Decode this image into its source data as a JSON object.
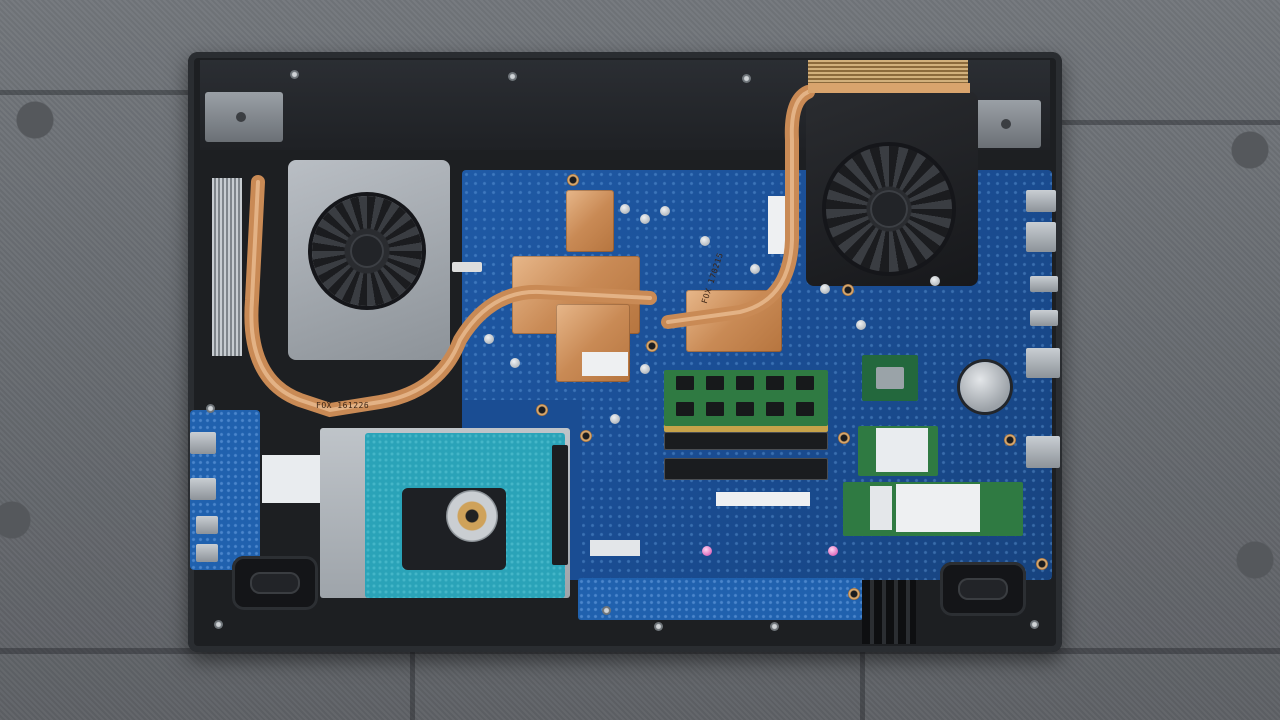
{
  "scene": {
    "alt": "Photograph of an opened laptop bottom showing motherboard, cooling fans, copper heat pipes, RAM, SSD, Wi-Fi card and hard drive on a grey fabric couch"
  },
  "labels": {
    "heatpipe_left": "FOX 161226",
    "heatpipe_right": "FOX 170215"
  },
  "colors": {
    "background": "#6f7277",
    "pcb": "#1a4d93",
    "copper": "#c98a55",
    "hdd_pcb": "#2aa3b8",
    "ram_pcb": "#2f7a42",
    "chassis": "#1d1f22"
  }
}
